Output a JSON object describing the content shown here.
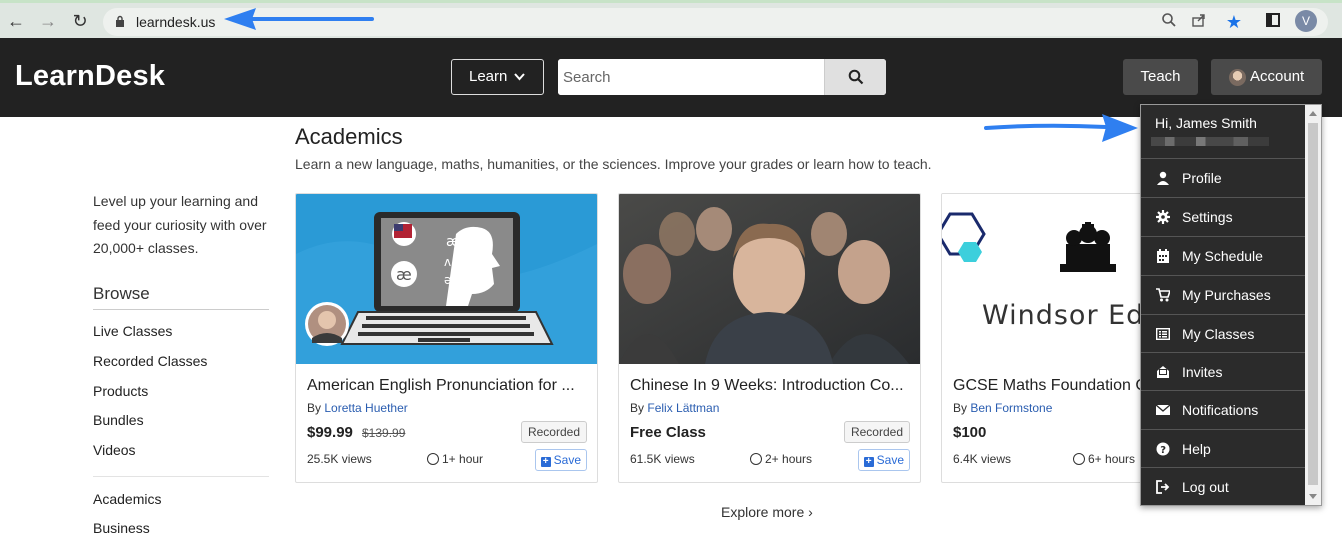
{
  "browser": {
    "url": "learndesk.us",
    "profile_initial": "V"
  },
  "header": {
    "brand": "LearnDesk",
    "learn_label": "Learn",
    "search_placeholder": "Search",
    "teach_label": "Teach",
    "account_label": "Account"
  },
  "sidebar": {
    "intro": "Level up your learning and feed your curiosity with over 20,000+ classes.",
    "browse_heading": "Browse",
    "browse_links": [
      "Live Classes",
      "Recorded Classes",
      "Products",
      "Bundles",
      "Videos"
    ],
    "category_links": [
      "Academics",
      "Business"
    ]
  },
  "main": {
    "section_title": "Academics",
    "section_subtitle": "Learn a new language, maths, humanities, or the sciences. Improve your grades or learn how to teach.",
    "cards": [
      {
        "title": "American English Pronunciation for ...",
        "by_prefix": "By",
        "instructor": "Loretta Huether",
        "price": "$99.99",
        "old_price": "$139.99",
        "badge": "Recorded",
        "views": "25.5K views",
        "duration": "1+ hour",
        "save_label": "Save"
      },
      {
        "title": "Chinese In 9 Weeks: Introduction Co...",
        "by_prefix": "By",
        "instructor": "Felix Lättman",
        "price": "Free Class",
        "old_price": "",
        "badge": "Recorded",
        "views": "61.5K views",
        "duration": "2+ hours",
        "save_label": "Save"
      },
      {
        "title": "GCSE Maths Foundation C",
        "by_prefix": "By",
        "instructor": "Ben Formstone",
        "price": "$100",
        "old_price": "",
        "badge": "",
        "views": "6.4K views",
        "duration": "6+ hours",
        "save_label": "",
        "image_text": "Windsor Educ"
      }
    ],
    "explore_label": "Explore more"
  },
  "account_menu": {
    "greeting": "Hi, James Smith",
    "items": [
      {
        "label": "Profile",
        "icon": "user-icon"
      },
      {
        "label": "Settings",
        "icon": "gear-icon"
      },
      {
        "label": "My Schedule",
        "icon": "calendar-icon"
      },
      {
        "label": "My Purchases",
        "icon": "cart-icon"
      },
      {
        "label": "My Classes",
        "icon": "list-icon"
      },
      {
        "label": "Invites",
        "icon": "envelope-open-icon"
      },
      {
        "label": "Notifications",
        "icon": "envelope-icon"
      },
      {
        "label": "Help",
        "icon": "question-icon"
      },
      {
        "label": "Log out",
        "icon": "logout-icon"
      }
    ]
  },
  "colors": {
    "header_bg": "#222222",
    "link_blue": "#2a5db0",
    "annotation_arrow": "#2f7ff0",
    "menu_bg": "#2b2b2b"
  }
}
